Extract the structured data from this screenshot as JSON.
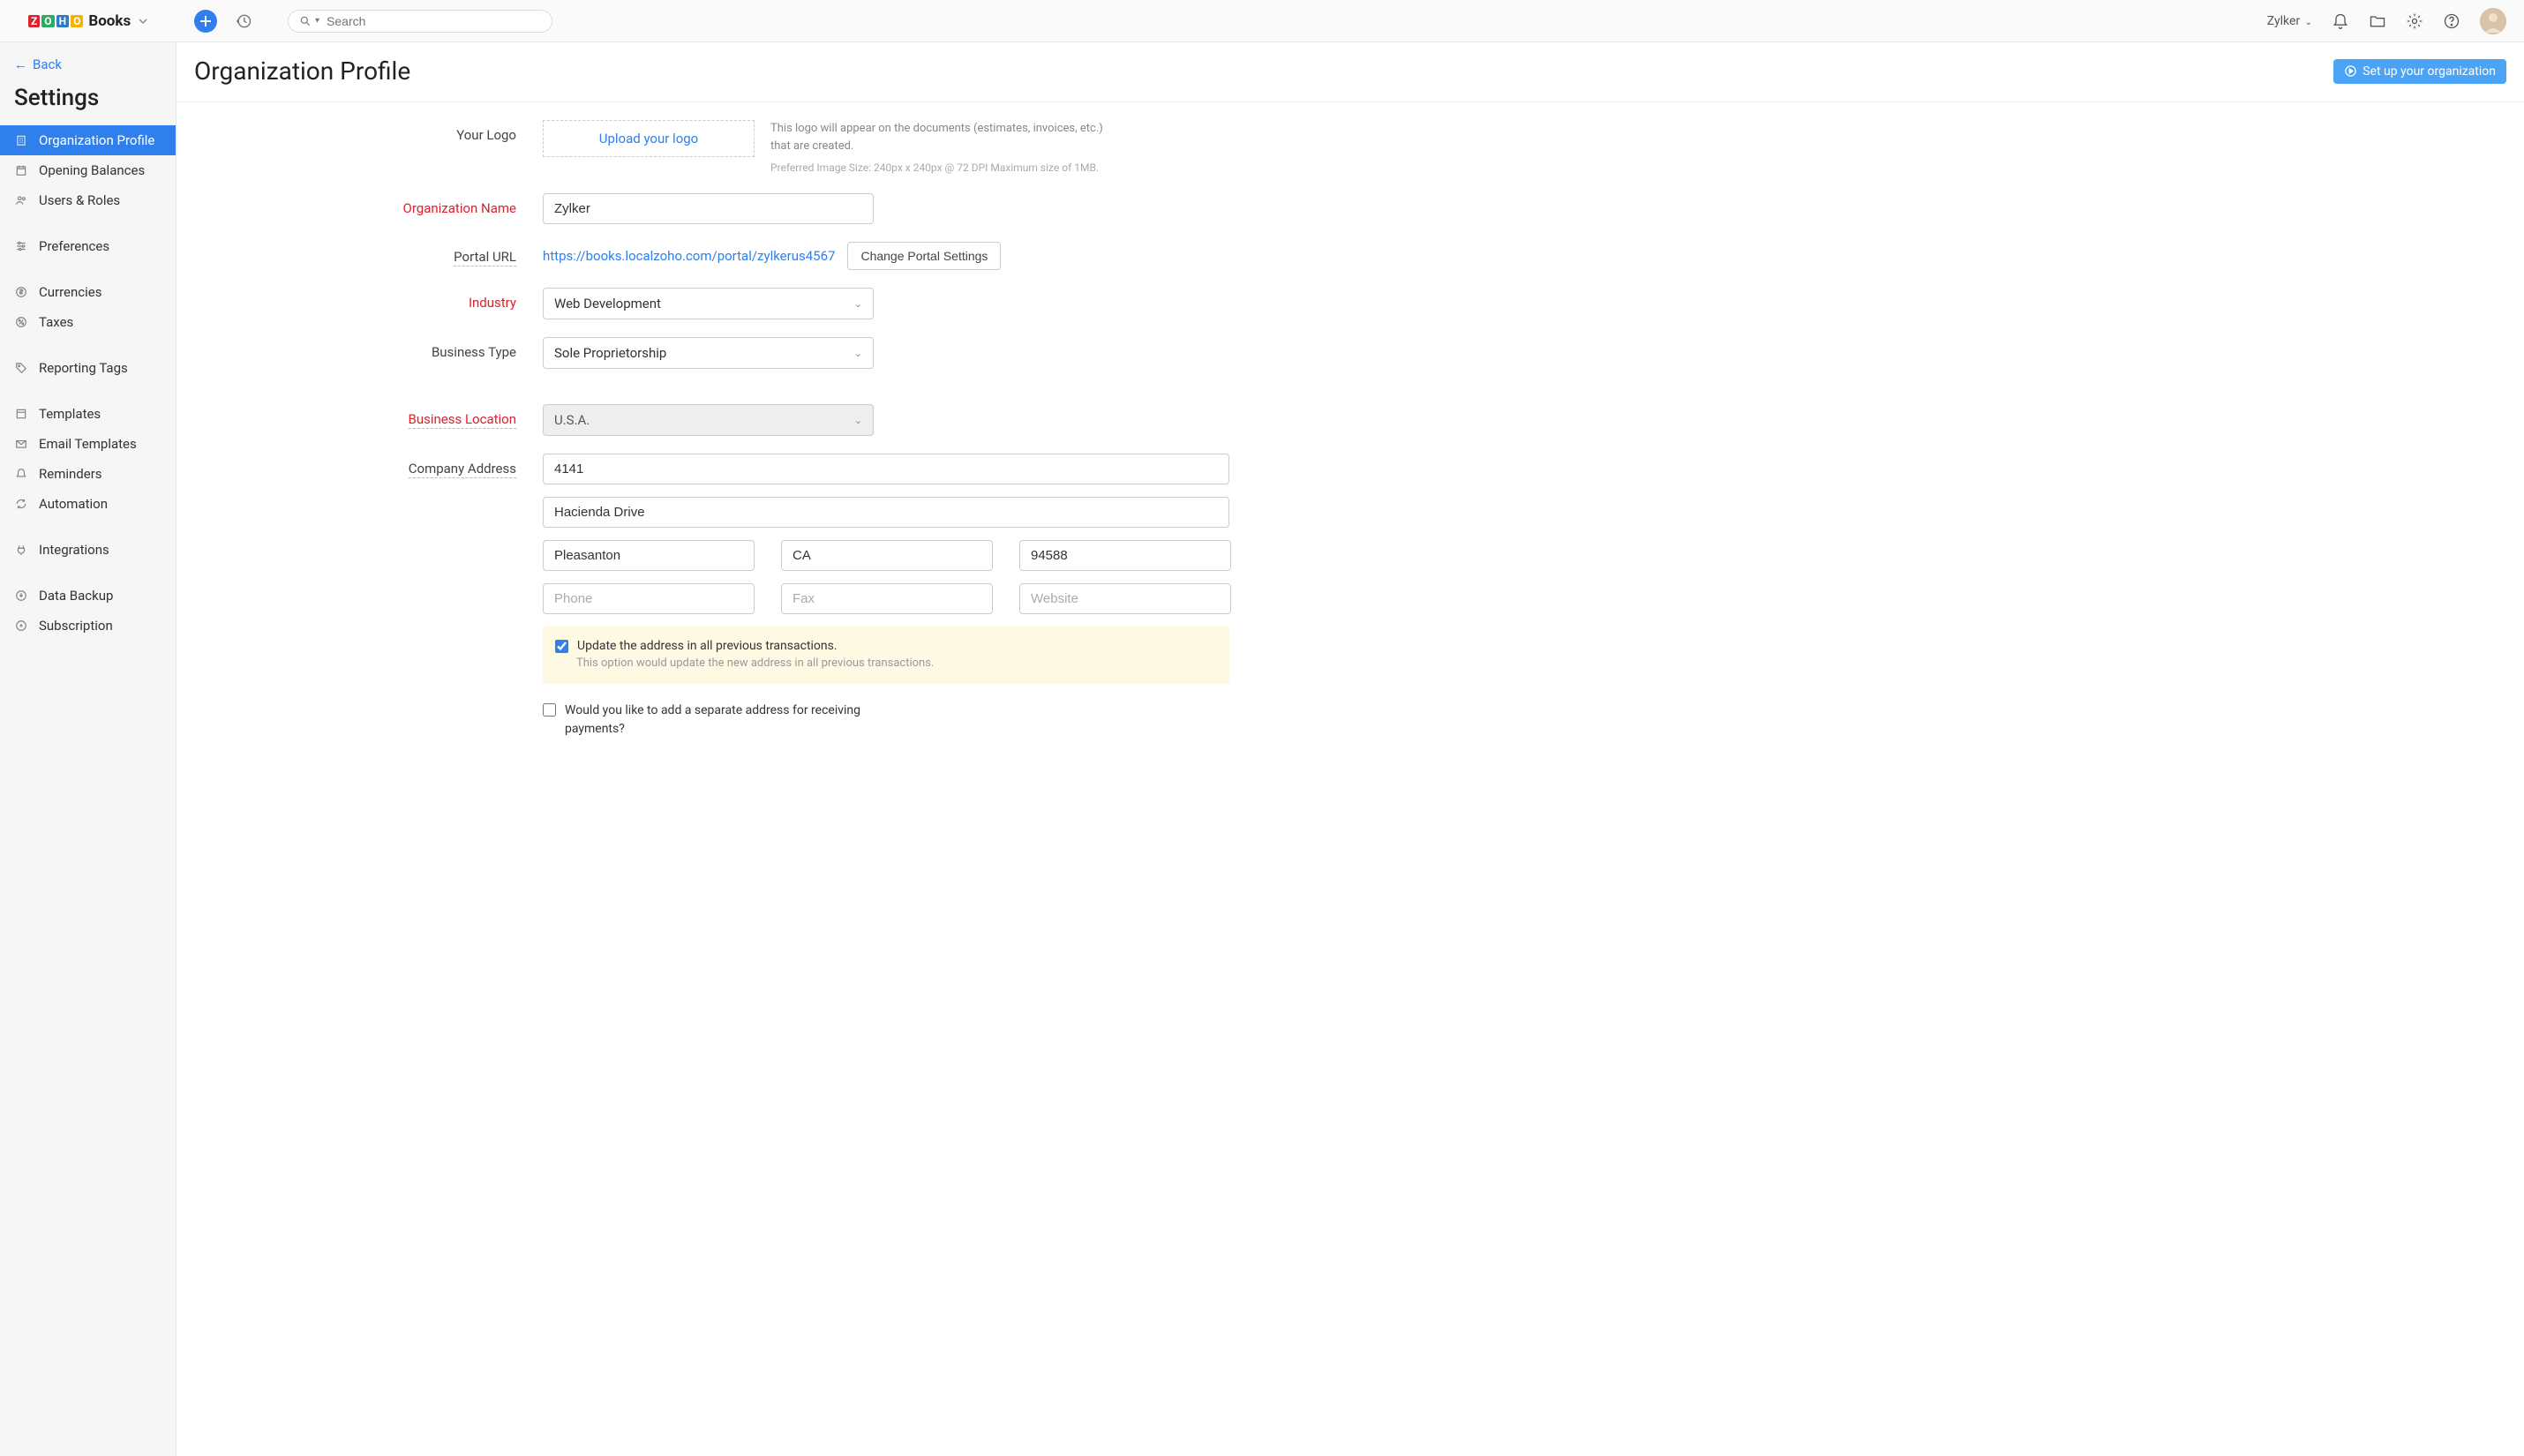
{
  "header": {
    "brand": "Books",
    "org_name": "Zylker",
    "search_placeholder": "Search"
  },
  "sidebar": {
    "back": "Back",
    "title": "Settings",
    "items": [
      {
        "label": "Organization Profile",
        "active": true
      },
      {
        "label": "Opening Balances"
      },
      {
        "label": "Users & Roles"
      },
      {
        "label": "Preferences"
      },
      {
        "label": "Currencies"
      },
      {
        "label": "Taxes"
      },
      {
        "label": "Reporting Tags"
      },
      {
        "label": "Templates"
      },
      {
        "label": "Email Templates"
      },
      {
        "label": "Reminders"
      },
      {
        "label": "Automation"
      },
      {
        "label": "Integrations"
      },
      {
        "label": "Data Backup"
      },
      {
        "label": "Subscription"
      }
    ]
  },
  "page": {
    "title": "Organization Profile",
    "setup_btn": "Set up your organization"
  },
  "form": {
    "logo_label": "Your Logo",
    "upload_logo": "Upload your logo",
    "logo_help": "This logo will appear on the documents (estimates, invoices, etc.) that are created.",
    "logo_help2": "Preferred Image Size: 240px x 240px @ 72 DPI Maximum size of 1MB.",
    "org_name_label": "Organization Name",
    "org_name_value": "Zylker",
    "portal_label": "Portal URL",
    "portal_url": "https://books.localzoho.com/portal/zylkerus4567",
    "portal_button": "Change Portal Settings",
    "industry_label": "Industry",
    "industry_value": "Web Development",
    "biztype_label": "Business Type",
    "biztype_value": "Sole Proprietorship",
    "location_label": "Business Location",
    "location_value": "U.S.A.",
    "address_label": "Company Address",
    "addr1": "4141",
    "addr2": "Hacienda Drive",
    "city": "Pleasanton",
    "state": "CA",
    "zip": "94588",
    "phone_ph": "Phone",
    "fax_ph": "Fax",
    "website_ph": "Website",
    "update_checkbox": "Update the address in all previous transactions.",
    "update_sub": "This option would update the new address in all previous transactions.",
    "separate_addr": "Would you like to add a separate address for receiving payments?"
  }
}
